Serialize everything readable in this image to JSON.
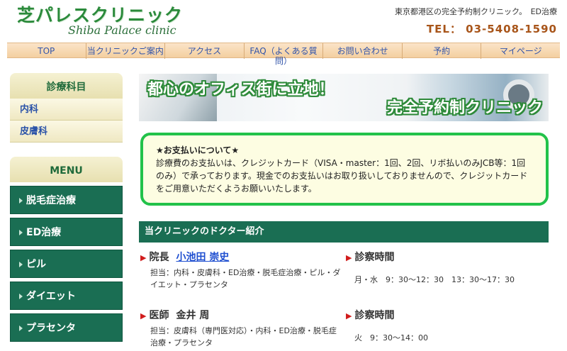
{
  "header": {
    "logo_jp": "芝パレスクリニック",
    "logo_en": "Shiba Palace clinic",
    "tagline": "東京都港区の完全予約制クリニック。　ED治療",
    "tel": "TEL： 03-5408-1590"
  },
  "nav": {
    "items": [
      {
        "label": "TOP"
      },
      {
        "label": "当クリニックご案内"
      },
      {
        "label": "アクセス"
      },
      {
        "label": "FAQ（よくある質",
        "label2": "問）"
      },
      {
        "label": "お問い合わせ"
      },
      {
        "label": "予約"
      },
      {
        "label": "マイページ"
      }
    ]
  },
  "sidebar": {
    "dept_title": "診療科目",
    "depts": [
      "内科",
      "皮膚科"
    ],
    "menu_title": "MENU",
    "menu": [
      "脱毛症治療",
      "ED治療",
      "ピル",
      "ダイエット",
      "プラセンタ"
    ]
  },
  "banner": {
    "line1": "都心のオフィス街に立地！",
    "line2": "完全予約制クリニック"
  },
  "notice": {
    "title": "★お支払いについて★",
    "body": "診療費のお支払いは、クレジットカード（VISA・master：1回、2回、リボ払いのみJCB等：1回のみ）で承っております。現金でのお支払いはお取り扱いしておりませんので、クレジットカードをご用意いただくようお願いいたします。"
  },
  "doctors": {
    "heading": "当クリニックのドクター紹介",
    "list": [
      {
        "role": "院長",
        "name": "小池田 崇史",
        "desc": "担当：内科・皮膚科・ED治療・脱毛症治療・ピル・ダイエット・プラセンタ",
        "hours_label": "診察時間",
        "hours": "月・水　9：30〜12：30　13：30〜17：30"
      },
      {
        "role": "医師",
        "name": "金井 周",
        "desc": "担当：皮膚科（専門医対応）・内科・ED治療・脱毛症治療・プラセンタ",
        "hours_label": "診察時間",
        "hours": "火　9：30〜14：00"
      }
    ]
  }
}
